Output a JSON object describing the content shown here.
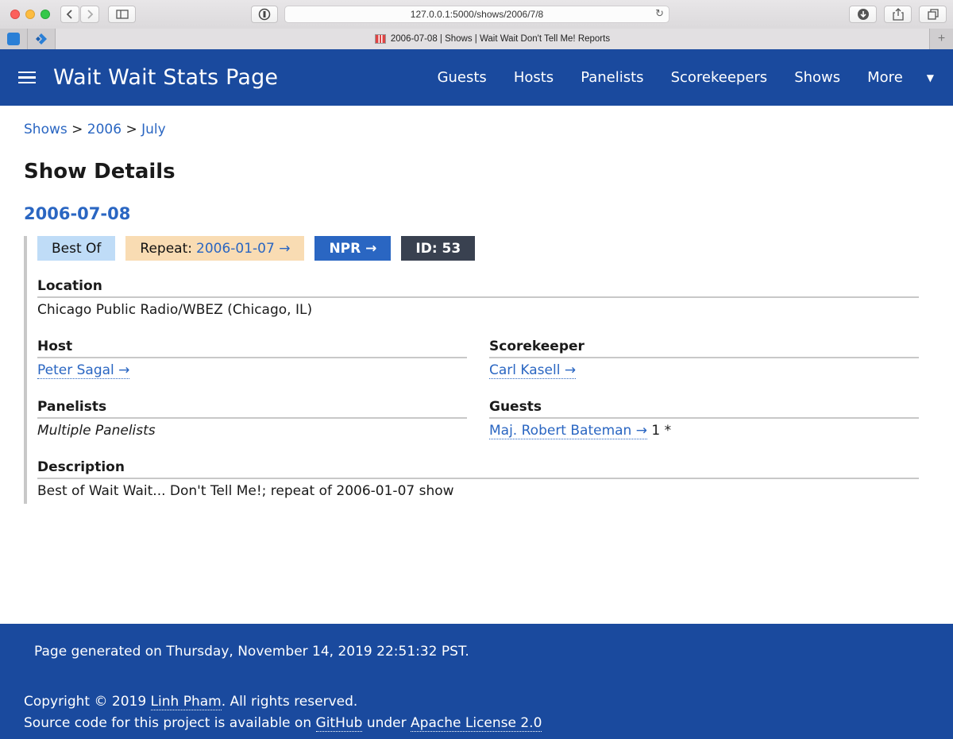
{
  "browser": {
    "url": "127.0.0.1:5000/shows/2006/7/8",
    "tab_title": "2006-07-08 | Shows | Wait Wait Don't Tell Me! Reports",
    "new_tab": "+"
  },
  "navbar": {
    "brand": "Wait Wait Stats Page",
    "links": [
      "Guests",
      "Hosts",
      "Panelists",
      "Scorekeepers",
      "Shows",
      "More"
    ]
  },
  "breadcrumb": {
    "items": [
      "Shows",
      "2006",
      "July"
    ],
    "separator": ">"
  },
  "page": {
    "title": "Show Details",
    "show_date": "2006-07-08"
  },
  "badges": {
    "best_of": "Best Of",
    "repeat_label": "Repeat:",
    "repeat_link": "2006-01-07 →",
    "npr": "NPR →",
    "id": "ID: 53"
  },
  "details": {
    "location": {
      "heading": "Location",
      "value": "Chicago Public Radio/WBEZ (Chicago, IL)"
    },
    "host": {
      "heading": "Host",
      "value": "Peter Sagal →"
    },
    "scorekeeper": {
      "heading": "Scorekeeper",
      "value": "Carl Kasell →"
    },
    "panelists": {
      "heading": "Panelists",
      "value": "Multiple Panelists"
    },
    "guests": {
      "heading": "Guests",
      "name": "Maj. Robert Bateman →",
      "score": "1 *"
    },
    "description": {
      "heading": "Description",
      "value": "Best of Wait Wait... Don't Tell Me!; repeat of 2006-01-07 show"
    }
  },
  "footer": {
    "generated": "Page generated on Thursday, November 14, 2019 22:51:32 PST.",
    "copyright_prefix": "Copyright © 2019",
    "author": "Linh Pham",
    "copyright_suffix": ". All rights reserved.",
    "source_prefix": "Source code for this project is available on",
    "github": "GitHub",
    "source_mid": "under",
    "license": "Apache License 2.0"
  }
}
